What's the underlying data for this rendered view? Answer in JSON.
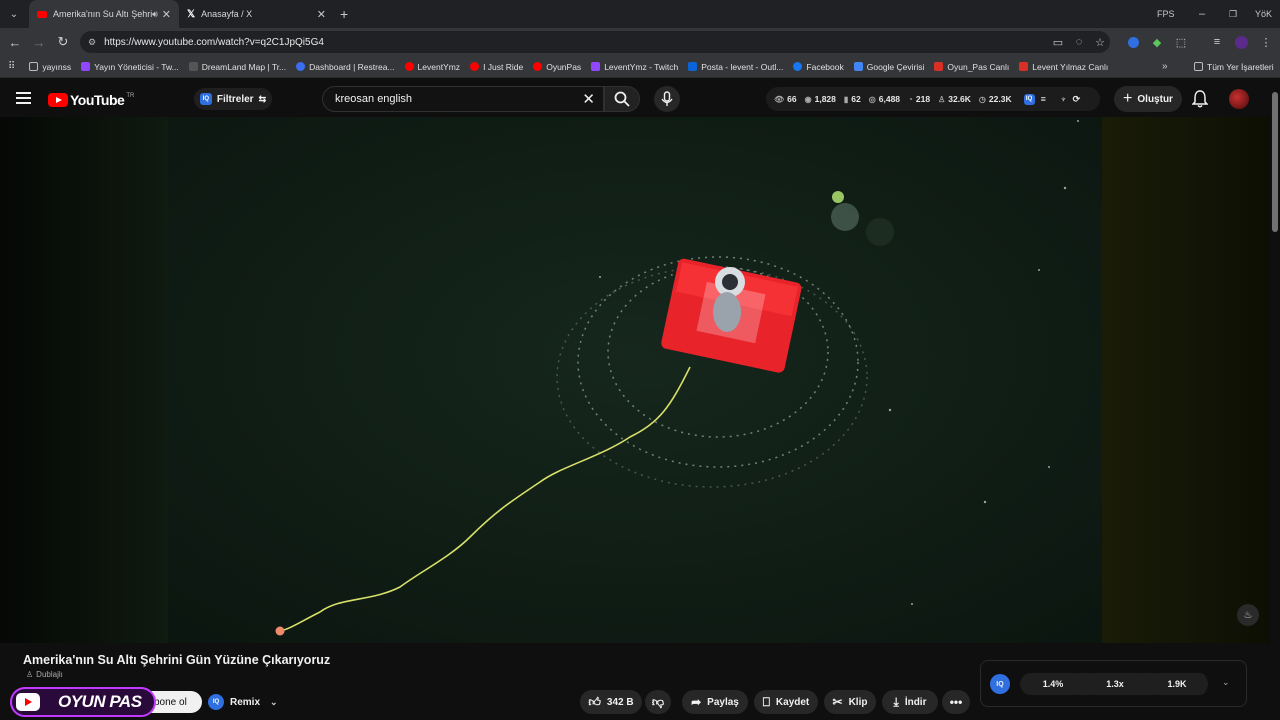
{
  "browser": {
    "tabs": [
      {
        "title": "Amerika'nın Su Altı Şehrini",
        "active": true
      },
      {
        "title": "Anasayfa / X",
        "active": false
      }
    ],
    "fps_label": "FPS",
    "profile_label": "YöK",
    "url": "https://www.youtube.com/watch?v=q2C1JpQi5G4",
    "bookmarks": [
      {
        "label": "yayınss",
        "color": "#8a8a8a"
      },
      {
        "label": "Yayın Yöneticisi - Tw...",
        "color": "#9146ff"
      },
      {
        "label": "DreamLand Map | Tr...",
        "color": "#444444"
      },
      {
        "label": "Dashboard | Restrea...",
        "color": "#3a6df0"
      },
      {
        "label": "LeventYmz",
        "color": "#ff0000"
      },
      {
        "label": "I Just Ride",
        "color": "#ff0000"
      },
      {
        "label": "OyunPas",
        "color": "#ff0000"
      },
      {
        "label": "LeventYmz - Twitch",
        "color": "#9146ff"
      },
      {
        "label": "Posta - levent - Outl...",
        "color": "#0a64d8"
      },
      {
        "label": "Facebook",
        "color": "#1877f2"
      },
      {
        "label": "Google Çevirisi",
        "color": "#4285f4"
      },
      {
        "label": "Oyun_Pas Canlı",
        "color": "#d93025"
      },
      {
        "label": "Levent Yılmaz Canlı",
        "color": "#d93025"
      }
    ],
    "all_bookmarks": "Tüm Yer İşaretleri"
  },
  "youtube": {
    "logo": "YouTube",
    "country": "TR",
    "filters_label": "Filtreler",
    "search_value": "kreosan english",
    "stats": [
      "66",
      "1,828",
      "62",
      "6,488",
      "218",
      "32.6K",
      "22.3K"
    ],
    "create_label": "Oluştur"
  },
  "video": {
    "title": "Amerika'nın Su Altı Şehrini Gün Yüzüne Çıkarıyoruz",
    "dubbed_label": "Dublajlı",
    "channel_name": "OYUN PAS",
    "subscribe_label": "Abone ol",
    "subscribe_visible": "bone ol",
    "remix_label": "Remix",
    "likes": "342 B",
    "share_label": "Paylaş",
    "save_label": "Kaydet",
    "clip_label": "Klip",
    "download_label": "İndir"
  },
  "iq_panel": {
    "badge": "IQ",
    "values": [
      "1.4%",
      "1.3x",
      "1.9K"
    ]
  },
  "colors": {
    "accent_red": "#ff0000",
    "raft_red": "#e8232a",
    "water": "#0d1a14",
    "oyunpas_border": "#c23aff"
  }
}
